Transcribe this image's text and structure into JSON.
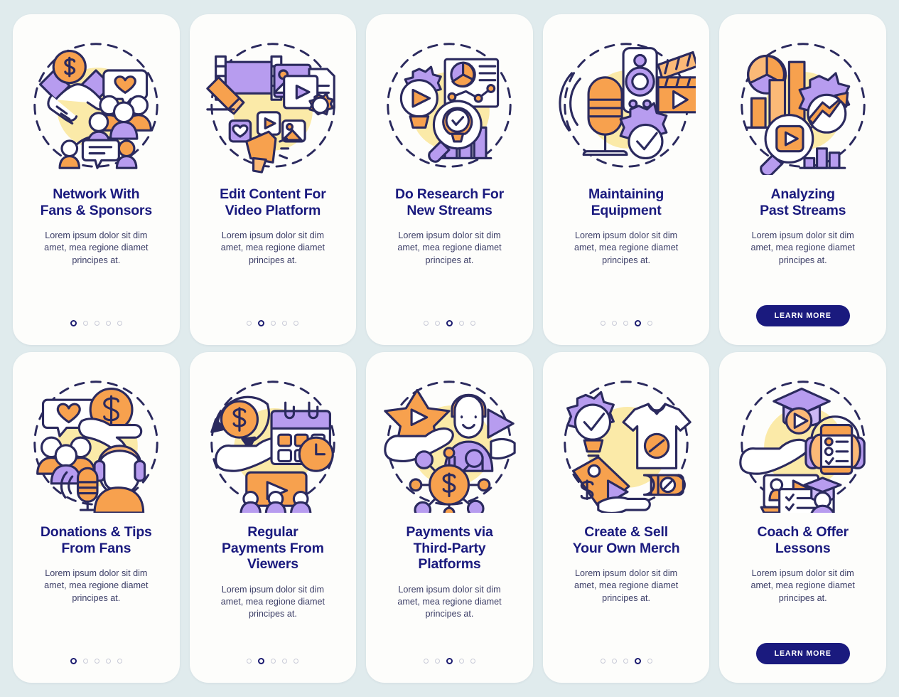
{
  "palette": {
    "background": "#e0ebed",
    "card": "#fdfdfb",
    "title": "#1a1a7e",
    "body": "#3b3d66",
    "outline": "#2b2a5e",
    "orange": "#f7a14e",
    "orange_light": "#fbb977",
    "purple": "#b79cef",
    "purple_light": "#cbb8f5",
    "yellow_blob": "#fbeaa8",
    "dot_inactive": "#c9cbd8",
    "dot_active": "#1c1c70",
    "button": "#1a1a7e",
    "white": "#ffffff"
  },
  "common": {
    "body_text": "Lorem ipsum dolor sit dim amet, mea regione diamet principes at.",
    "learn_more_label": "LEARN MORE",
    "dots_count": 5
  },
  "cards": [
    {
      "id": "network-with-fans-sponsors",
      "title_line1": "Network With",
      "title_line2": "Fans & Sponsors",
      "title_line3": "",
      "body_text": "Lorem ipsum dolor sit dim amet, mea regione diamet principes at.",
      "active_dot": 1,
      "has_button": false,
      "illustration": "handshake-dollar-community",
      "icon_names": [
        "dollar-coin-icon",
        "handshake-icon",
        "heart-speech-bubble-icon",
        "people-group-icon",
        "chat-bubble-icon"
      ]
    },
    {
      "id": "edit-content-for-video-platform",
      "title_line1": "Edit Content For",
      "title_line2": "Video Platform",
      "title_line3": "",
      "body_text": "Lorem ipsum dolor sit dim amet, mea regione diamet principes at.",
      "active_dot": 2,
      "has_button": false,
      "illustration": "video-editing-tools",
      "icon_names": [
        "film-strip-icon",
        "pencil-icon",
        "image-card-icon",
        "play-card-icon",
        "document-icon",
        "gear-icon",
        "heart-tile-icon",
        "photo-tile-icon",
        "megaphone-icon"
      ]
    },
    {
      "id": "do-research-for-new-streams",
      "title_line1": "Do Research For",
      "title_line2": "New Streams",
      "title_line3": "",
      "body_text": "Lorem ipsum dolor sit dim amet, mea regione diamet principes at.",
      "active_dot": 3,
      "has_button": false,
      "illustration": "research-analytics",
      "icon_names": [
        "gear-play-icon",
        "pie-chart-report-icon",
        "line-chart-icon",
        "magnifier-lightbulb-icon",
        "bar-chart-icon"
      ]
    },
    {
      "id": "maintaining-equipment",
      "title_line1": "Maintaining",
      "title_line2": "Equipment",
      "title_line3": "",
      "body_text": "Lorem ipsum dolor sit dim amet, mea regione diamet principes at.",
      "active_dot": 4,
      "has_button": false,
      "illustration": "equipment-maintenance",
      "icon_names": [
        "microphone-icon",
        "camera-icon",
        "clapperboard-icon",
        "gear-check-icon"
      ]
    },
    {
      "id": "analyzing-past-streams",
      "title_line1": "Analyzing",
      "title_line2": "Past Streams",
      "title_line3": "",
      "body_text": "Lorem ipsum dolor sit dim amet, mea regione diamet principes at.",
      "active_dot": 5,
      "has_button": true,
      "illustration": "analytics-growth",
      "icon_names": [
        "pie-chart-icon",
        "bar-chart-icon",
        "gear-arrow-up-icon",
        "magnifier-play-icon"
      ]
    },
    {
      "id": "donations-tips-from-fans",
      "title_line1": "Donations & Tips",
      "title_line2": "From Fans",
      "title_line3": "",
      "body_text": "Lorem ipsum dolor sit dim amet, mea regione diamet principes at.",
      "active_dot": 1,
      "has_button": false,
      "illustration": "donations-streamer",
      "icon_names": [
        "heart-speech-bubble-icon",
        "dollar-coin-icon",
        "open-hand-icon",
        "people-group-icon",
        "streamer-headset-icon",
        "microphone-icon"
      ]
    },
    {
      "id": "regular-payments-from-viewers",
      "title_line1": "Regular",
      "title_line2": "Payments From",
      "title_line3": "Viewers",
      "body_text": "Lorem ipsum dolor sit dim amet, mea regione diamet principes at.",
      "active_dot": 2,
      "has_button": false,
      "illustration": "recurring-payments",
      "icon_names": [
        "dollar-coin-recycle-icon",
        "open-hand-icon",
        "calendar-clock-icon",
        "video-audience-icon"
      ]
    },
    {
      "id": "payments-via-third-party-platforms",
      "title_line1": "Payments via",
      "title_line2": "Third-Party",
      "title_line3": "Platforms",
      "body_text": "Lorem ipsum dolor sit dim amet, mea regione diamet principes at.",
      "active_dot": 3,
      "has_button": false,
      "illustration": "third-party-payments",
      "icon_names": [
        "star-play-icon",
        "open-hand-icon",
        "person-icon",
        "play-arrow-icon",
        "dollar-network-icon"
      ]
    },
    {
      "id": "create-sell-your-own-merch",
      "title_line1": "Create & Sell",
      "title_line2": "Your Own Merch",
      "title_line3": "",
      "body_text": "Lorem ipsum dolor sit dim amet, mea regione diamet principes at.",
      "active_dot": 4,
      "has_button": false,
      "illustration": "merch-creation",
      "icon_names": [
        "gear-lightbulb-check-icon",
        "tshirt-icon",
        "price-tag-icon",
        "bottle-icon",
        "hand-icon"
      ]
    },
    {
      "id": "coach-offer-lessons",
      "title_line1": "Coach & Offer",
      "title_line2": "Lessons",
      "title_line3": "",
      "body_text": "Lorem ipsum dolor sit dim amet, mea regione diamet principes at.",
      "active_dot": 5,
      "has_button": true,
      "illustration": "coaching-lessons",
      "icon_names": [
        "graduation-cap-icon",
        "play-circle-icon",
        "open-hand-icon",
        "headphones-phone-checklist-icon",
        "video-lesson-icon",
        "student-certificate-icon"
      ]
    }
  ]
}
